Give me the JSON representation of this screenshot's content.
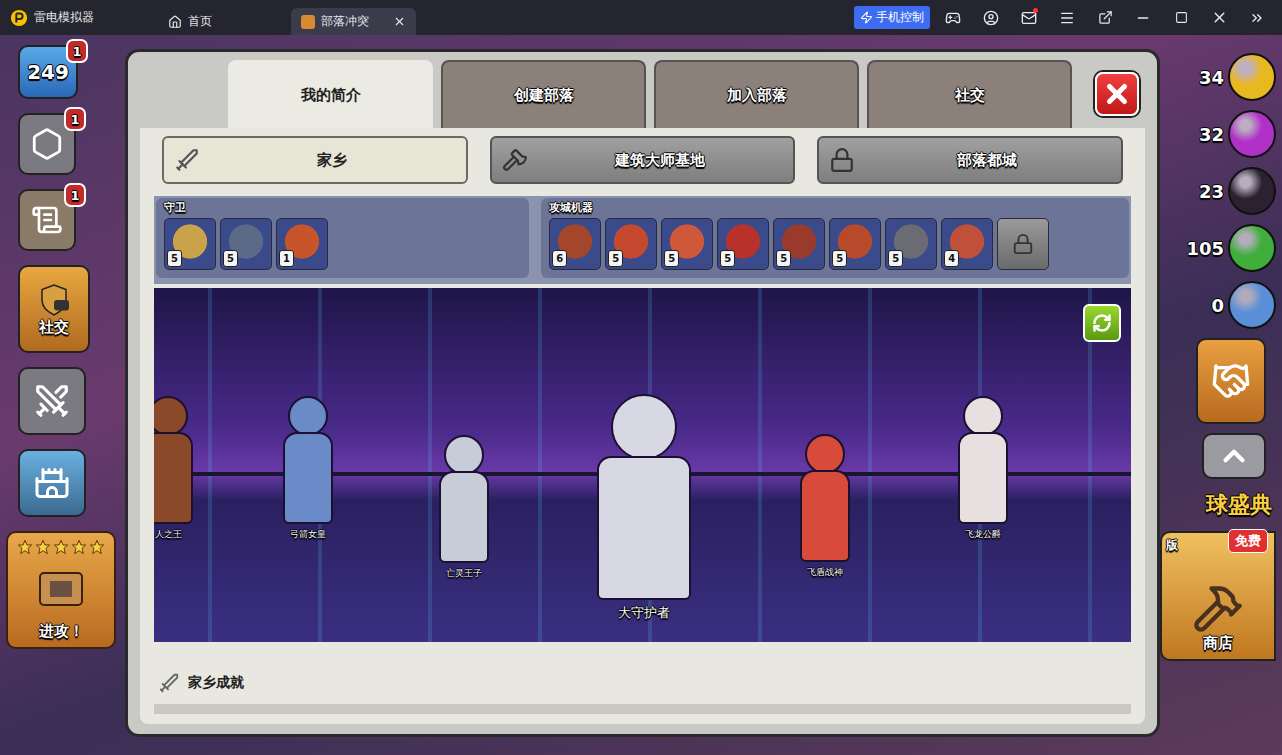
{
  "emulator": {
    "app_name": "雷电模拟器",
    "tabs": [
      {
        "label": "首页",
        "selected": false
      },
      {
        "label": "部落冲突",
        "selected": true
      }
    ],
    "phone_control": "手机控制",
    "mail_unread": true
  },
  "hud_left": {
    "level": "249",
    "level_notice": "1",
    "hex_notice": "1",
    "scroll_notice": "1",
    "social": "社交",
    "attack": "进攻！",
    "attack_stars": 5
  },
  "hud_right": {
    "resources": [
      {
        "amount": "34",
        "color": "#e8b820"
      },
      {
        "amount": "32",
        "color": "#b030c8"
      },
      {
        "amount": "23",
        "color": "#2a2230"
      },
      {
        "amount": "105",
        "color": "#3fae3a"
      },
      {
        "amount": "0",
        "color": "#5a8fd8"
      }
    ],
    "event_banner": "球盛典",
    "edition": "版",
    "free_tag": "免费",
    "shop": "商店"
  },
  "modal": {
    "tabs": [
      {
        "label": "我的简介",
        "selected": true
      },
      {
        "label": "创建部落",
        "selected": false
      },
      {
        "label": "加入部落",
        "selected": false
      },
      {
        "label": "社交",
        "selected": false
      }
    ],
    "sub_tabs": [
      {
        "label": "家乡",
        "selected": true
      },
      {
        "label": "建筑大师基地",
        "selected": false
      },
      {
        "label": "部落都城",
        "selected": false
      }
    ],
    "guards": {
      "title": "守卫",
      "items": [
        {
          "level": "5",
          "locked": false,
          "color": "#c9a24a"
        },
        {
          "level": "5",
          "locked": false,
          "color": "#5b6a86"
        },
        {
          "level": "1",
          "locked": false,
          "color": "#c8552a"
        }
      ]
    },
    "siege": {
      "title": "攻城机器",
      "items": [
        {
          "level": "6",
          "locked": false,
          "color": "#a3462a"
        },
        {
          "level": "5",
          "locked": false,
          "color": "#c4492e"
        },
        {
          "level": "5",
          "locked": false,
          "color": "#d0583a"
        },
        {
          "level": "5",
          "locked": false,
          "color": "#b8312a"
        },
        {
          "level": "5",
          "locked": false,
          "color": "#9a3a2a"
        },
        {
          "level": "5",
          "locked": false,
          "color": "#b84a2c"
        },
        {
          "level": "5",
          "locked": false,
          "color": "#6b6b74"
        },
        {
          "level": "4",
          "locked": false,
          "color": "#c0503a"
        },
        {
          "level": "",
          "locked": true,
          "color": "#7a7a7a"
        }
      ]
    },
    "heroes": [
      {
        "name": "人之王",
        "featured": false,
        "color": "#8a4a2a"
      },
      {
        "name": "弓箭女皇",
        "featured": false,
        "color": "#6a8ac8"
      },
      {
        "name": "亡灵王子",
        "featured": false,
        "color": "#c8ccd8"
      },
      {
        "name": "大守护者",
        "featured": true,
        "color": "#d8d8e4"
      },
      {
        "name": "飞盾战神",
        "featured": false,
        "color": "#d84a3a"
      },
      {
        "name": "飞龙公爵",
        "featured": false,
        "color": "#e8e0e0"
      }
    ],
    "achievements": {
      "title": "家乡成就"
    }
  }
}
